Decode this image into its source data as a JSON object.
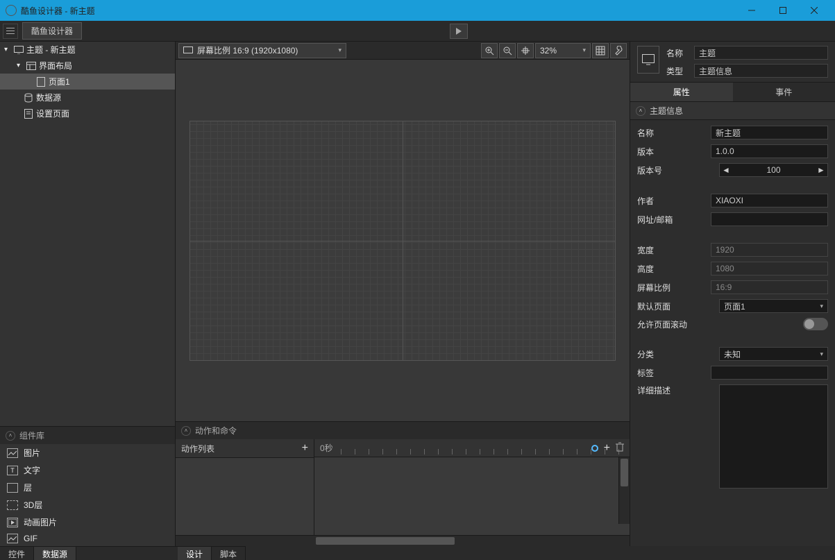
{
  "window": {
    "title": "酷鱼设计器 - 新主题"
  },
  "menubar": {
    "app_button": "酷鱼设计器"
  },
  "tree": {
    "root": "主题 - 新主题",
    "layout": "界面布局",
    "page": "页面1",
    "datasource": "数据源",
    "settings": "设置页面"
  },
  "component_lib": {
    "title": "组件库",
    "items": [
      "图片",
      "文字",
      "层",
      "3D层",
      "动画图片",
      "GIF"
    ]
  },
  "left_tabs": {
    "controls": "控件",
    "datasource": "数据源"
  },
  "canvas": {
    "ratio_label": "屏幕比例 16:9 (1920x1080)",
    "zoom": "32%"
  },
  "timeline": {
    "title": "动作和命令",
    "action_list": "动作列表",
    "zero": "0秒"
  },
  "center_tabs": {
    "design": "设计",
    "script": "脚本"
  },
  "inspector": {
    "name_label": "名称",
    "name_value": "主题",
    "type_label": "类型",
    "type_value": "主题信息",
    "tabs": {
      "props": "属性",
      "events": "事件"
    },
    "section": "主题信息",
    "props": {
      "name": {
        "label": "名称",
        "value": "新主题"
      },
      "version": {
        "label": "版本",
        "value": "1.0.0"
      },
      "version_num": {
        "label": "版本号",
        "value": "100"
      },
      "author": {
        "label": "作者",
        "value": "XIAOXI"
      },
      "url": {
        "label": "网址/邮箱",
        "value": ""
      },
      "width": {
        "label": "宽度",
        "value": "1920"
      },
      "height": {
        "label": "高度",
        "value": "1080"
      },
      "ratio": {
        "label": "屏幕比例",
        "value": "16:9"
      },
      "default_page": {
        "label": "默认页面",
        "value": "页面1"
      },
      "allow_scroll": {
        "label": "允许页面滚动"
      },
      "category": {
        "label": "分类",
        "value": "未知"
      },
      "tags": {
        "label": "标签",
        "value": ""
      },
      "desc": {
        "label": "详细描述"
      }
    }
  }
}
